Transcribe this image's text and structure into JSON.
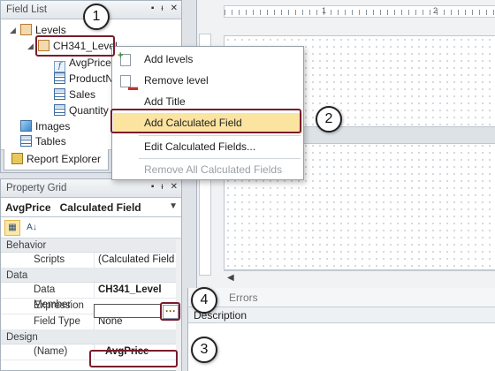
{
  "field_list": {
    "title": "Field List",
    "tree": {
      "levels": "Levels",
      "level_item": "CH341_Level",
      "fields": [
        "AvgPrice",
        "ProductNa",
        "Sales",
        "Quantity"
      ],
      "images": "Images",
      "tables": "Tables"
    },
    "tab_label": "Report Explorer"
  },
  "context_menu": {
    "items": [
      {
        "label": "Add levels",
        "icon": "add-level-icon"
      },
      {
        "label": "Remove level",
        "icon": "remove-level-icon"
      },
      {
        "label": "Add Title"
      },
      {
        "label": "Add Calculated Field"
      },
      {
        "label": "Edit Calculated Fields..."
      },
      {
        "label": "Remove All Calculated Fields",
        "disabled": true
      }
    ]
  },
  "property_grid": {
    "title": "Property Grid",
    "object_name": "AvgPrice",
    "object_type": "Calculated Field",
    "categories": [
      {
        "name": "Behavior",
        "rows": [
          {
            "name": "Scripts",
            "value": "(Calculated Field ..."
          }
        ]
      },
      {
        "name": "Data",
        "rows": [
          {
            "name": "Data Member",
            "value": "CH341_Level"
          },
          {
            "name": "Expression",
            "value": ""
          },
          {
            "name": "Field Type",
            "value": "None"
          }
        ]
      },
      {
        "name": "Design",
        "rows": [
          {
            "name": "(Name)",
            "value": "AvgPrice"
          }
        ]
      }
    ],
    "ellipsis": "···"
  },
  "errors_panel": {
    "tab": "Errors",
    "column": "Description"
  },
  "ruler": {
    "labels": [
      "1",
      "2"
    ]
  },
  "callouts": [
    "1",
    "2",
    "3",
    "4"
  ],
  "colors": {
    "highlight": "#fbe3a0",
    "callout_border": "#7a1c2c"
  }
}
